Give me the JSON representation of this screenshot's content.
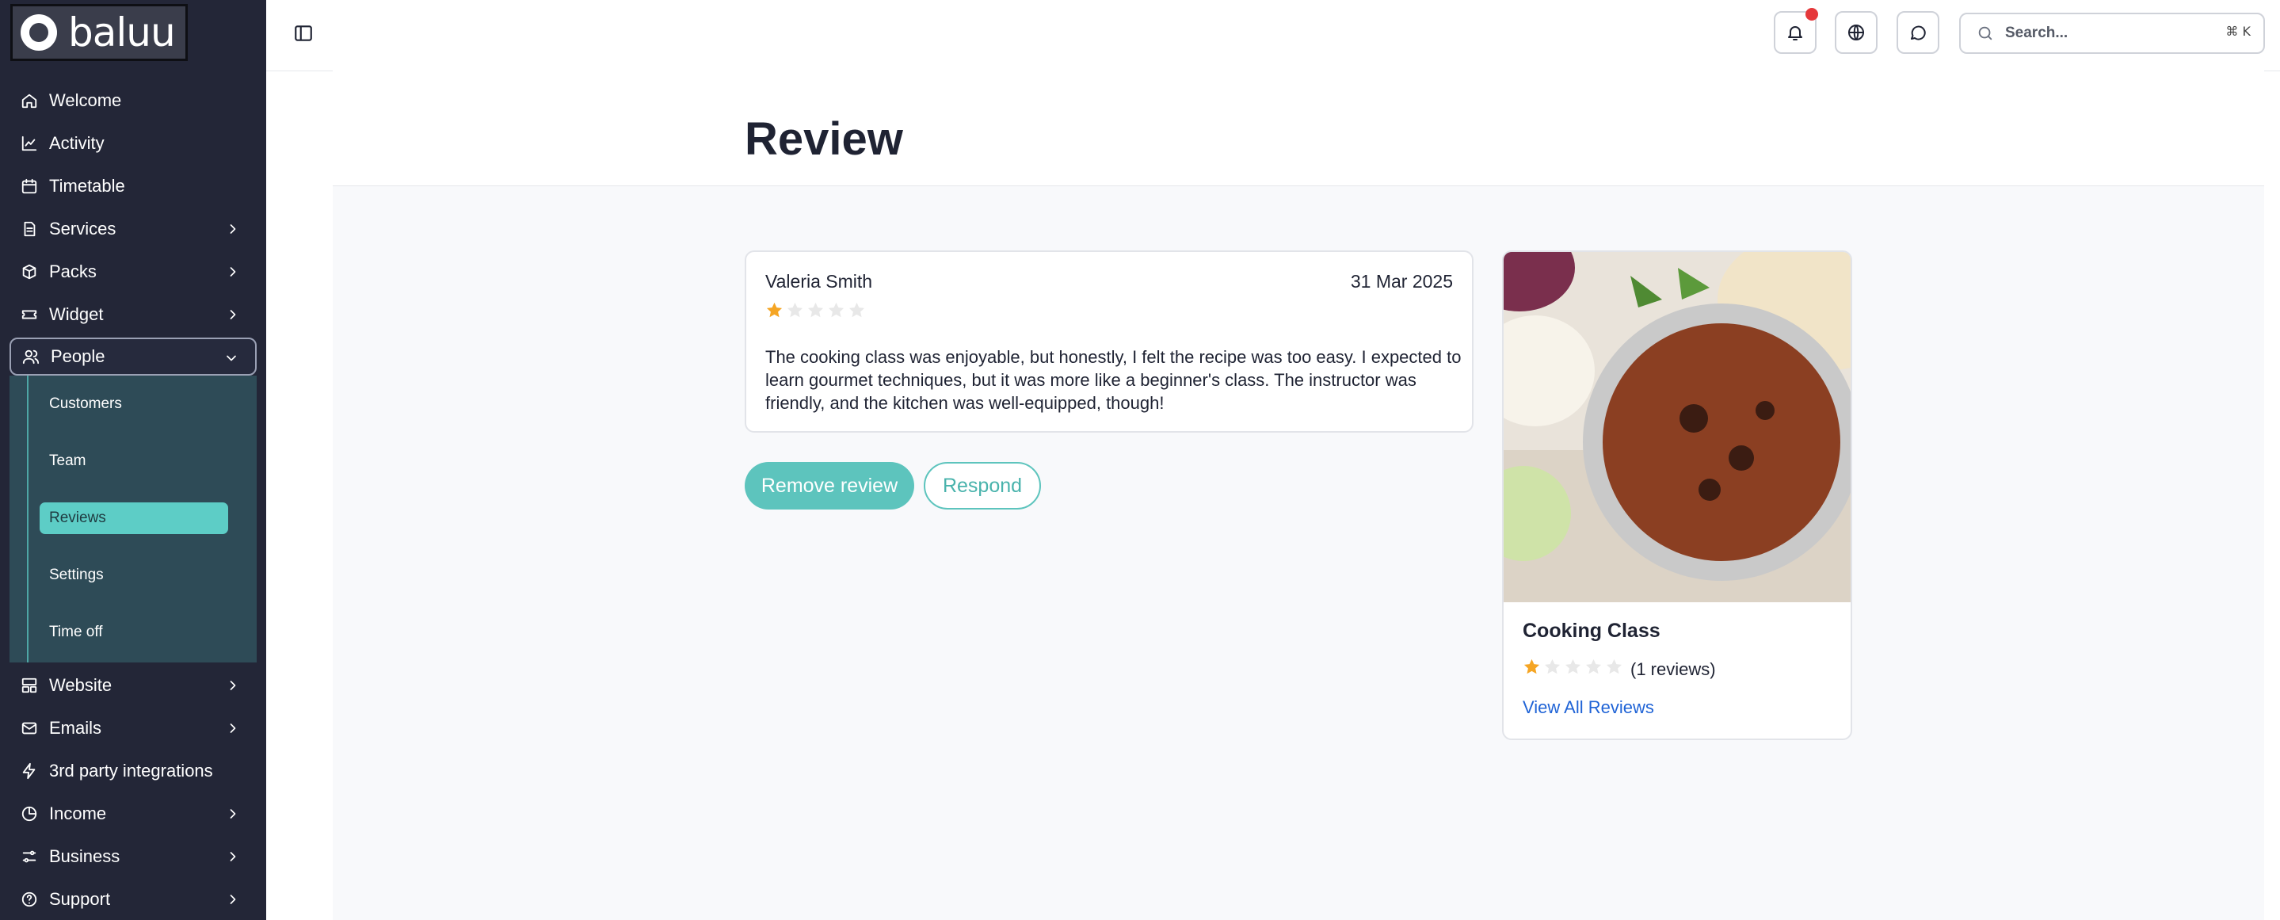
{
  "brand": {
    "name": "baluu"
  },
  "sidebar": {
    "items": [
      {
        "label": "Welcome",
        "icon": "home-icon"
      },
      {
        "label": "Activity",
        "icon": "chart-icon"
      },
      {
        "label": "Timetable",
        "icon": "calendar-icon"
      },
      {
        "label": "Services",
        "icon": "document-icon",
        "chevron": "right"
      },
      {
        "label": "Packs",
        "icon": "package-icon",
        "chevron": "right"
      },
      {
        "label": "Widget",
        "icon": "ticket-icon",
        "chevron": "right"
      },
      {
        "label": "People",
        "icon": "users-icon",
        "chevron": "down",
        "expanded": true
      },
      {
        "label": "Website",
        "icon": "layout-icon",
        "chevron": "right"
      },
      {
        "label": "Emails",
        "icon": "mail-icon",
        "chevron": "right"
      },
      {
        "label": "3rd party integrations",
        "icon": "bolt-icon"
      },
      {
        "label": "Income",
        "icon": "pie-icon",
        "chevron": "right"
      },
      {
        "label": "Business",
        "icon": "sliders-icon",
        "chevron": "right"
      },
      {
        "label": "Support",
        "icon": "help-icon",
        "chevron": "right"
      }
    ],
    "people_submenu": [
      {
        "label": "Customers"
      },
      {
        "label": "Team"
      },
      {
        "label": "Reviews",
        "active": true
      },
      {
        "label": "Settings"
      },
      {
        "label": "Time off"
      }
    ]
  },
  "header": {
    "search_placeholder": "Search...",
    "search_shortcut": "⌘ K",
    "notification_badge_color": "#e5383b"
  },
  "page": {
    "title": "Review"
  },
  "review": {
    "author": "Valeria Smith",
    "date": "31 Mar 2025",
    "rating": 1,
    "max_rating": 5,
    "text": "The cooking class was enjoyable, but honestly, I felt the recipe was too easy. I expected to learn gourmet techniques, but it was more like a beginner's class. The instructor was friendly, and the kitchen was well-equipped, though!"
  },
  "actions": {
    "remove_label": "Remove review",
    "respond_label": "Respond"
  },
  "product": {
    "name": "Cooking Class",
    "rating": 1,
    "max_rating": 5,
    "review_count": "(1 reviews)",
    "view_all_label": "View All Reviews"
  },
  "colors": {
    "sidebar_bg": "#232637",
    "accent_teal": "#5dc4bd",
    "link_blue": "#1f63d6",
    "star_filled": "#f5a524",
    "star_empty": "#e8e8e8"
  }
}
